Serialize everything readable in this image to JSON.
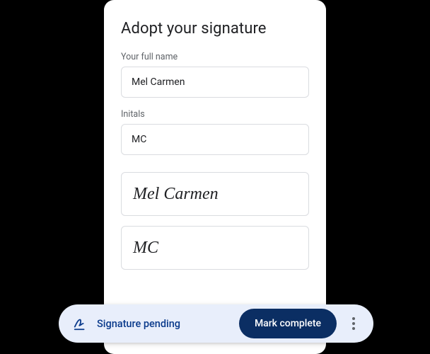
{
  "title": "Adopt your signature",
  "fields": {
    "fullName": {
      "label": "Your full name",
      "value": "Mel Carmen"
    },
    "initials": {
      "label": "Initals",
      "value": "MC"
    }
  },
  "signaturePreview": {
    "fullName": "Mel Carmen",
    "initials": "MC"
  },
  "statusBar": {
    "iconName": "signature-icon",
    "statusText": "Signature pending",
    "buttonLabel": "Mark complete",
    "accentColor": "#0b3b8c",
    "barBg": "#e8eefb"
  }
}
